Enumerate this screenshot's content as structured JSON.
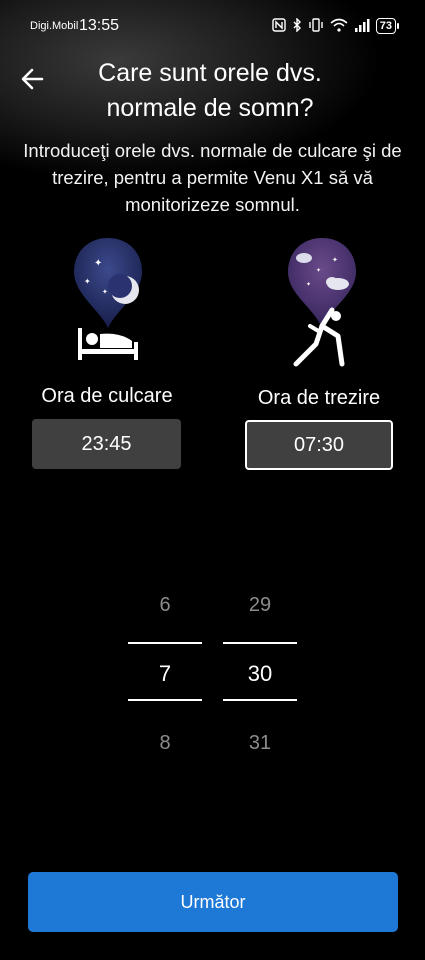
{
  "status_bar": {
    "carrier": "Digi.Mobil",
    "time": "13:55",
    "battery": "73",
    "icons": [
      "nfc-icon",
      "bluetooth-icon",
      "vibrate-icon",
      "wifi-icon",
      "signal-icon",
      "battery-icon"
    ]
  },
  "header": {
    "back_icon": "arrow-left-icon",
    "title": "Care sunt orele dvs. normale de somn?",
    "subtitle": "Introduceţi orele dvs. normale de culcare şi de trezire, pentru a permite Venu X1 să vă monitorizeze somnul."
  },
  "bedtime": {
    "label": "Ora de culcare",
    "value": "23:45",
    "icon": "bed-moon-icon"
  },
  "wake": {
    "label": "Ora de trezire",
    "value": "07:30",
    "icon": "stretching-person-icon"
  },
  "picker": {
    "hours": {
      "prev": "6",
      "selected": "7",
      "next": "8"
    },
    "minutes": {
      "prev": "29",
      "selected": "30",
      "next": "31"
    }
  },
  "footer": {
    "next_label": "Următor"
  },
  "colors": {
    "accent": "#1e78d6",
    "box_bg": "#404040"
  }
}
